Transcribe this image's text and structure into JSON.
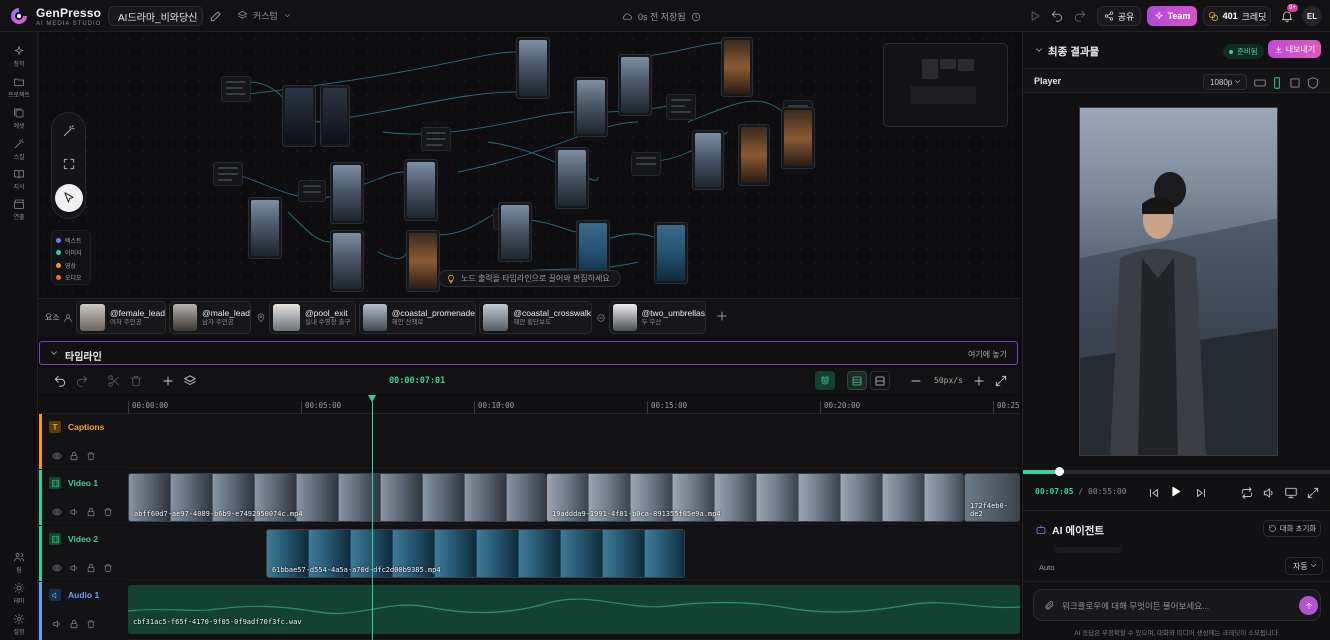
{
  "brand": {
    "name": "GenPresso",
    "subtitle": "AI MEDIA STUDIO"
  },
  "header": {
    "project_name": "AI드라마_비와당신",
    "workflow_label": "커스텀",
    "save_status": "0s 전 저장됨",
    "share_label": "공유",
    "team_label": "Team",
    "credits_value": "401",
    "credits_label": "크레딧",
    "notifications_badge": "9+",
    "avatar_initials": "EL"
  },
  "sidebar": {
    "items": [
      {
        "label": "창작",
        "icon": "sparkle-icon"
      },
      {
        "label": "프로젝트",
        "icon": "folder-icon"
      },
      {
        "label": "에셋",
        "icon": "image-stack-icon"
      },
      {
        "label": "스킬",
        "icon": "wand-icon"
      },
      {
        "label": "지식",
        "icon": "book-icon"
      },
      {
        "label": "연출",
        "icon": "clapper-icon"
      }
    ],
    "bottom": [
      {
        "label": "팀",
        "icon": "team-icon"
      },
      {
        "label": "테마",
        "icon": "sun-icon"
      },
      {
        "label": "설정",
        "icon": "settings-icon"
      }
    ]
  },
  "canvas": {
    "legend": [
      {
        "label": "텍스트",
        "color": "#6b7cff"
      },
      {
        "label": "이미지",
        "color": "#34d399"
      },
      {
        "label": "영상",
        "color": "#f59e0b"
      },
      {
        "label": "오디오",
        "color": "#f97316"
      }
    ],
    "hint": "노드 출력을 타임라인으로 끌어와 편집하세요"
  },
  "elements": {
    "label": "요소",
    "people": [
      {
        "handle": "@female_lead",
        "desc": "여자 주인공"
      },
      {
        "handle": "@male_lead",
        "desc": "남자 주인공"
      }
    ],
    "places": [
      {
        "handle": "@pool_exit",
        "desc": "실내 수영장 출구"
      },
      {
        "handle": "@coastal_promenade",
        "desc": "해안 산책로"
      },
      {
        "handle": "@coastal_crosswalk",
        "desc": "해안 횡단보도"
      }
    ],
    "objects": [
      {
        "handle": "@two_umbrellas",
        "desc": "두 우산"
      }
    ]
  },
  "timeline": {
    "title": "타임라인",
    "place_label": "여기에 놓기",
    "timecode": "00:00:07:01",
    "zoom": "50px/s",
    "ruler": [
      "00:00:00",
      "00:05:00",
      "00:10:00",
      "00:15:00",
      "00:20:00",
      "00:25"
    ],
    "tracks": [
      {
        "name": "Captions",
        "color": "#f59e0b",
        "tag": "T"
      },
      {
        "name": "Video 1",
        "color": "#34d399"
      },
      {
        "name": "Video 2",
        "color": "#34d399"
      },
      {
        "name": "Audio 1",
        "color": "#60a5fa"
      }
    ],
    "clips": {
      "video1": [
        "abff60d7-ae97-4089-b6b9-e7492950074c.mp4",
        "19addda9-1991-4f81-b0ca-891355f05e9a.mp4",
        "172f4eb0-de2"
      ],
      "video2": [
        "61bbae57-d554-4a5a-a70d-dfc2d00b9385.mp4"
      ],
      "audio1": [
        "cbf31ac5-f65f-4170-9f05-0f9adf70f3fc.wav"
      ]
    }
  },
  "final": {
    "title": "최종 결과물",
    "status": "준비됨",
    "export_label": "내보내기",
    "player_label": "Player",
    "resolution": "1080p",
    "current_time": "00:07:05",
    "total_time": "00:55:00",
    "progress": 0.13
  },
  "ai": {
    "title": "AI 에이전트",
    "reset_label": "대화 초기화",
    "model_label": "Auto",
    "mode_label": "자동",
    "input_placeholder": "워크플로우에 대해 무엇이든 물어보세요...",
    "disclaimer": "AI 응답은 부정확할 수 있으며, 대화와 미디어 생성에는 크레딧이 소모됩니다."
  }
}
